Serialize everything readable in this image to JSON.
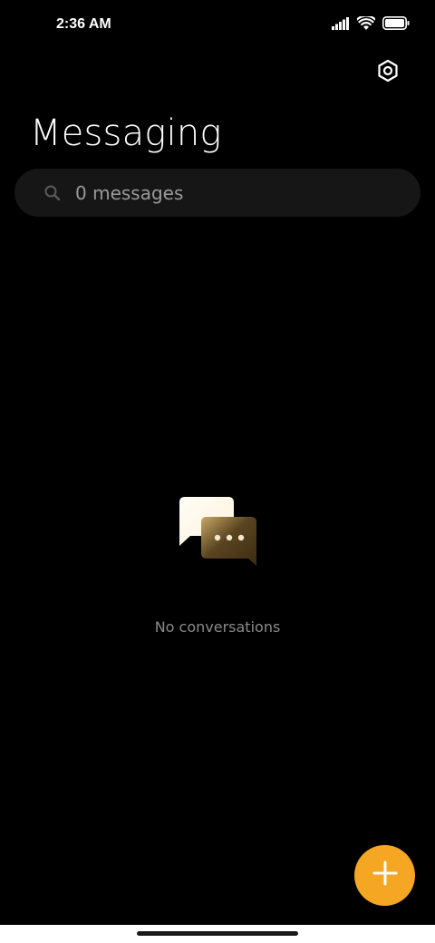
{
  "status_bar": {
    "time": "2:36 AM",
    "icons": [
      "signal-icon",
      "wifi-icon",
      "battery-icon"
    ]
  },
  "header": {
    "title": "Messaging",
    "settings_icon": "gear-icon"
  },
  "search": {
    "placeholder": "0 messages",
    "icon": "search-icon"
  },
  "empty_state": {
    "text": "No conversations",
    "icon": "chat-bubbles-icon"
  },
  "fab": {
    "icon": "plus-icon",
    "color": "#f5a623"
  },
  "colors": {
    "background": "#000000",
    "search_background": "#161616",
    "accent": "#f5a623",
    "muted_text": "#8a8a8a"
  }
}
